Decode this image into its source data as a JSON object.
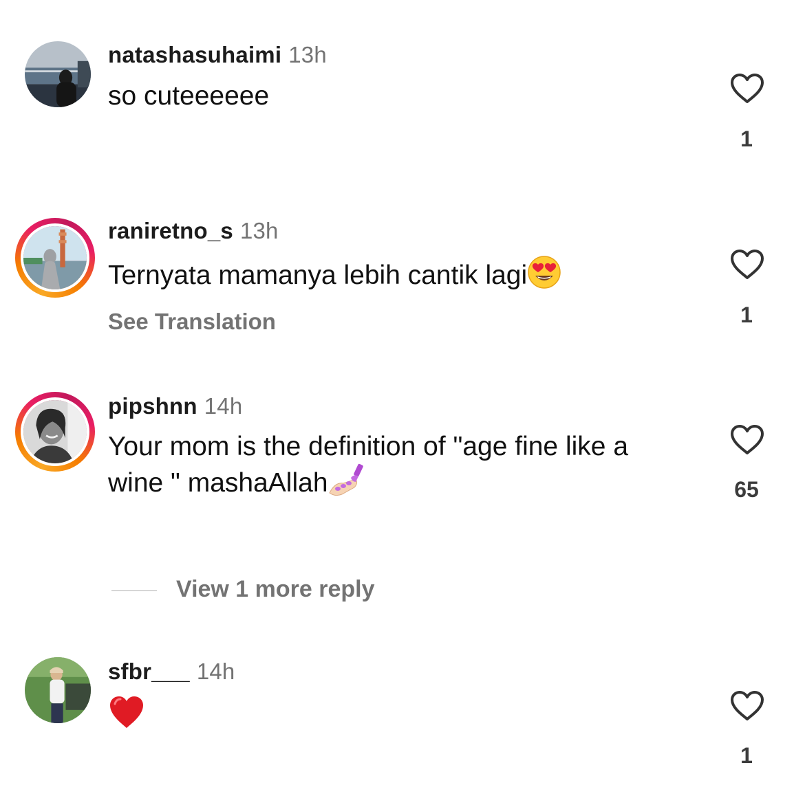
{
  "comments": [
    {
      "username": "natashasuhaimi",
      "time": "13h",
      "text": "so cuteeeeee",
      "likes": "1",
      "avatar": "photo-person-harbor",
      "story_ring": false
    },
    {
      "username": "raniretno_s",
      "time": "13h",
      "text": "Ternyata mamanya lebih cantik lagi",
      "text_emoji": "smiling-face-heart-eyes-emoji",
      "see_translation": "See Translation",
      "likes": "1",
      "avatar": "photo-person-hijab",
      "story_ring": true
    },
    {
      "username": "pipshnn",
      "time": "14h",
      "text": "Your mom is the definition of \"age fine like a wine \" mashaAllah",
      "text_emoji": "nail-polish-emoji",
      "likes": "65",
      "avatar": "photo-person-smiling-bw",
      "story_ring": true,
      "replies": {
        "label": "View 1 more reply"
      }
    },
    {
      "username": "sfbr___",
      "time": "14h",
      "text": "",
      "text_emoji": "red-heart-emoji",
      "likes": "1",
      "avatar": "photo-person-park",
      "story_ring": false
    }
  ],
  "icons": {
    "like": "heart-outline-icon"
  },
  "colors": {
    "muted_text": "#737373",
    "story_ring_start": "#f9a825",
    "story_ring_end": "#e91e63"
  }
}
